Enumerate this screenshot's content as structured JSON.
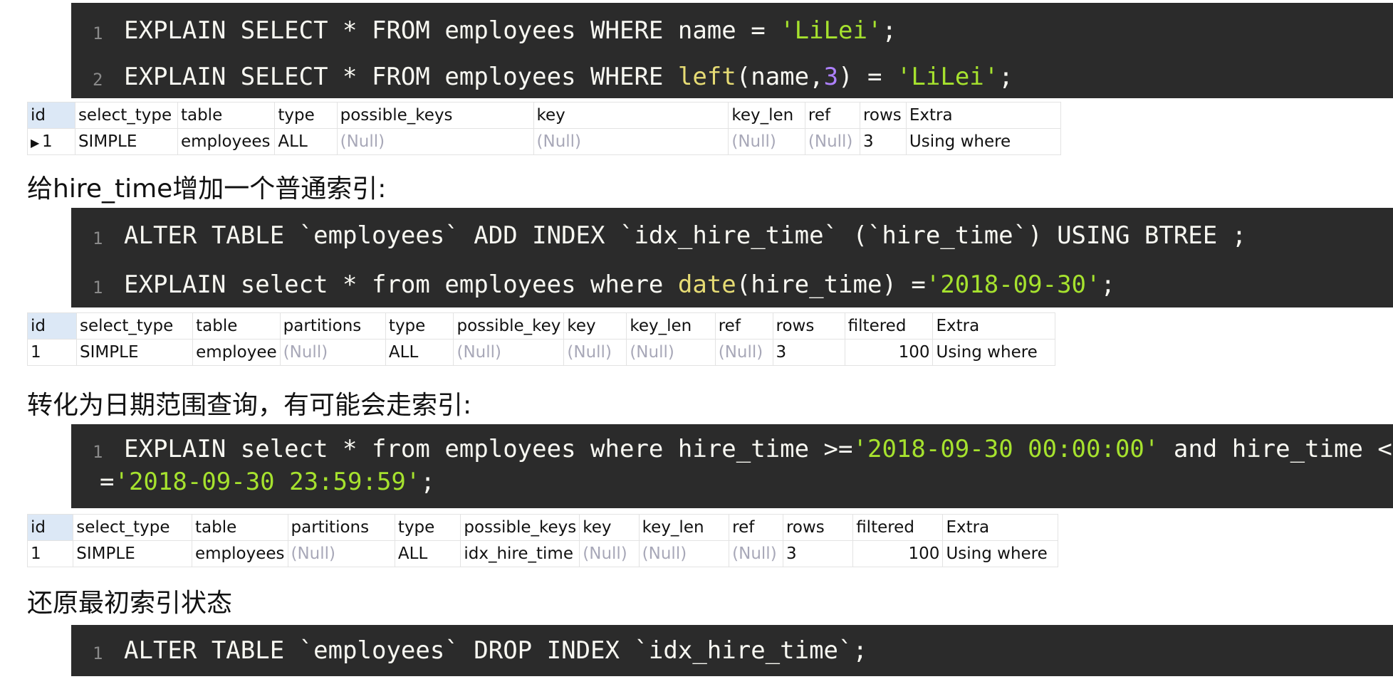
{
  "code_blocks": [
    {
      "lines": [
        {
          "num": "1",
          "text": "EXPLAIN SELECT * FROM employees WHERE name = ",
          "str": "'LiLei'",
          "end": ";"
        },
        {
          "num": "2",
          "text": "EXPLAIN SELECT * FROM employees WHERE ",
          "fn": "left",
          "mid": "(name,",
          "n": "3",
          "mid2": ") = ",
          "str": "'LiLei'",
          "end": ";"
        }
      ]
    },
    {
      "lines": [
        {
          "num": "1",
          "text": "ALTER TABLE `employees` ADD INDEX `idx_hire_time` (`hire_time`) USING BTREE ;"
        },
        {
          "num": "1",
          "text": "EXPLAIN select * from employees where ",
          "fn": "date",
          "mid": "(hire_time) =",
          "str": "'2018-09-30'",
          "end": ";"
        }
      ]
    },
    {
      "lines": [
        {
          "num": "1",
          "text": "EXPLAIN select * from employees where hire_time >=",
          "str": "'2018-09-30 00:00:00'",
          "mid": " and hire_time <"
        },
        {
          "num": "",
          "text": "=",
          "str": "'2018-09-30 23:59:59'",
          "end": ";"
        }
      ]
    },
    {
      "lines": [
        {
          "num": "1",
          "text": "ALTER TABLE `employees` DROP INDEX `idx_hire_time`;"
        }
      ]
    }
  ],
  "captions": [
    "给hire_time增加一个普通索引:",
    "转化为日期范围查询，有可能会走索引:",
    "还原最初索引状态"
  ],
  "tables": [
    {
      "headers": [
        "id",
        "select_type",
        "table",
        "type",
        "possible_keys",
        "key",
        "key_len",
        "ref",
        "rows",
        "Extra"
      ],
      "row": [
        "1",
        "SIMPLE",
        "employees",
        "ALL",
        "(Null)",
        "(Null)",
        "(Null)",
        "(Null)",
        "3",
        "Using where"
      ]
    },
    {
      "headers": [
        "id",
        "select_type",
        "table",
        "partitions",
        "type",
        "possible_key",
        "key",
        "key_len",
        "ref",
        "rows",
        "filtered",
        "Extra"
      ],
      "row": [
        "1",
        "SIMPLE",
        "employee",
        "(Null)",
        "ALL",
        "(Null)",
        "(Null)",
        "(Null)",
        "(Null)",
        "3",
        "100",
        "Using where"
      ]
    },
    {
      "headers": [
        "id",
        "select_type",
        "table",
        "partitions",
        "type",
        "possible_keys",
        "key",
        "key_len",
        "ref",
        "rows",
        "filtered",
        "Extra"
      ],
      "row": [
        "1",
        "SIMPLE",
        "employees",
        "(Null)",
        "ALL",
        "idx_hire_time",
        "(Null)",
        "(Null)",
        "(Null)",
        "3",
        "100",
        "Using where"
      ]
    }
  ]
}
